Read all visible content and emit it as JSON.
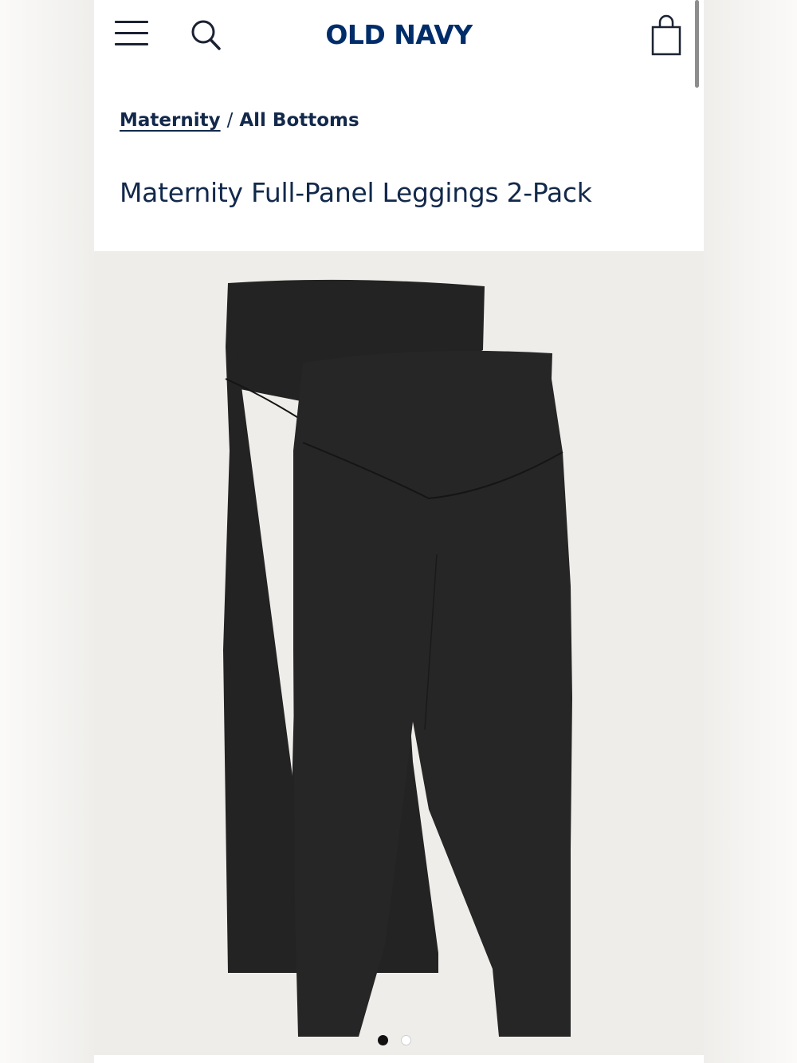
{
  "brand": {
    "logo_text": "OLD NAVY",
    "primary_color": "#002d6a",
    "text_color": "#13294b"
  },
  "header": {
    "menu_icon": "hamburger-menu-icon",
    "search_icon": "search-icon",
    "bag_icon": "shopping-bag-icon"
  },
  "breadcrumb": {
    "parent": "Maternity",
    "separator": "/",
    "current": "All Bottoms"
  },
  "product": {
    "title": "Maternity Full-Panel Leggings 2-Pack",
    "image_description_icon": "leggings-product-image",
    "product_color": "#1f1f1f"
  },
  "gallery": {
    "total_images": 2,
    "active_index": 0,
    "background": "#efedea"
  }
}
